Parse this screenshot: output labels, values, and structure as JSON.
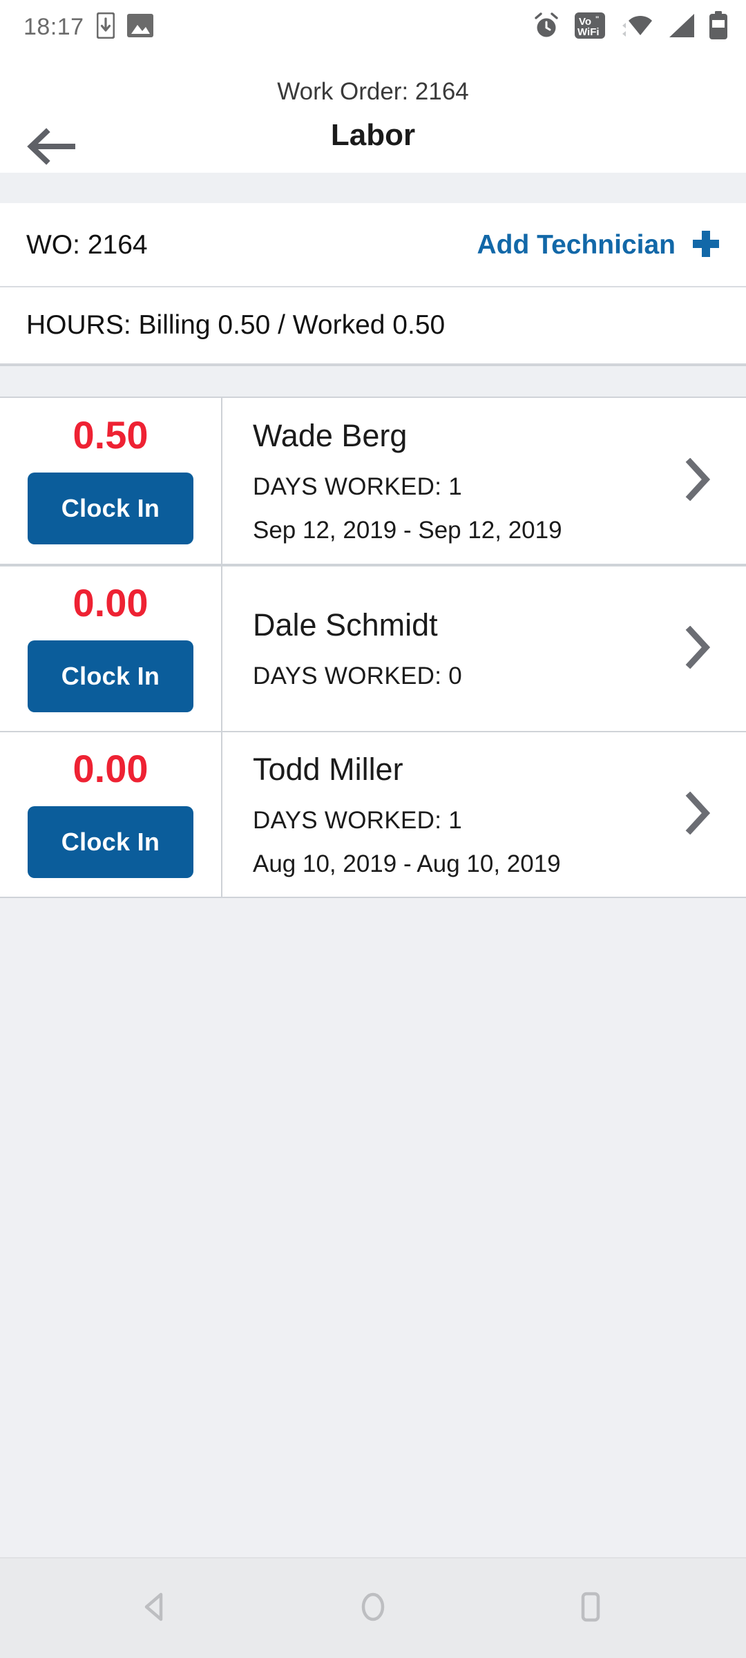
{
  "status_bar": {
    "time": "18:17",
    "left_icons": [
      "phone-download-icon",
      "image-icon"
    ],
    "right_icons": [
      "alarm-clock-icon",
      "vowifi-icon",
      "wifi-icon",
      "cellular-signal-icon",
      "battery-icon"
    ],
    "vowifi_top": "Vo",
    "vowifi_bottom": "WiFi"
  },
  "app_bar": {
    "subtitle": "Work Order: 2164",
    "title": "Labor",
    "back_icon": "arrow-left-icon"
  },
  "wo_row": {
    "wo_label": "WO: 2164",
    "add_technician_label": "Add Technician",
    "add_icon": "plus-icon"
  },
  "hours_row": {
    "text": "HOURS: Billing 0.50 / Worked 0.50"
  },
  "technicians": [
    {
      "hours": "0.50",
      "button_label": "Clock In",
      "name": "Wade Berg",
      "days_worked": "DAYS WORKED: 1",
      "dates": "Sep 12, 2019 - Sep 12, 2019",
      "chevron": "chevron-right-icon"
    },
    {
      "hours": "0.00",
      "button_label": "Clock In",
      "name": "Dale Schmidt",
      "days_worked": "DAYS WORKED: 0",
      "dates": "",
      "chevron": "chevron-right-icon"
    },
    {
      "hours": "0.00",
      "button_label": "Clock In",
      "name": "Todd Miller",
      "days_worked": "DAYS WORKED: 1",
      "dates": "Aug 10, 2019 - Aug 10, 2019",
      "chevron": "chevron-right-icon"
    }
  ],
  "nav_bar": {
    "back": "nav-back-icon",
    "home": "nav-home-icon",
    "recents": "nav-recents-icon"
  },
  "colors": {
    "accent_blue": "#0b5d9b",
    "link_blue": "#1268a8",
    "hours_red": "#ee2233",
    "page_bg": "#eff0f3",
    "card_bg": "#ffffff",
    "divider": "#cfd3d8"
  }
}
